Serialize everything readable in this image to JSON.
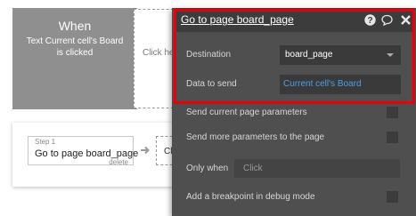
{
  "event": {
    "title": "When",
    "description": "Text Current cell's Board is clicked"
  },
  "placeholder_event": {
    "label": "Click he"
  },
  "action_step": {
    "step_label": "Step 1",
    "title": "Go to page board_page",
    "delete_label": "delete"
  },
  "next_step": {
    "label": "Cl"
  },
  "panel": {
    "title": "Go to page board_page",
    "icons": [
      "help-icon",
      "comment-icon",
      "close-icon"
    ],
    "destination": {
      "label": "Destination",
      "value": "board_page"
    },
    "data_to_send": {
      "label": "Data to send",
      "value": "Current cell's Board"
    },
    "send_current_params": {
      "label": "Send current page parameters",
      "checked": false
    },
    "send_more_params": {
      "label": "Send more parameters to the page",
      "checked": false
    },
    "only_when": {
      "label": "Only when",
      "placeholder": "Click"
    },
    "breakpoint": {
      "label": "Add a breakpoint in debug mode",
      "checked": false
    }
  },
  "colors": {
    "highlight": "#e8000a",
    "dynamic_value": "#4a9fe8",
    "panel_bg": "#4f4f4f"
  }
}
